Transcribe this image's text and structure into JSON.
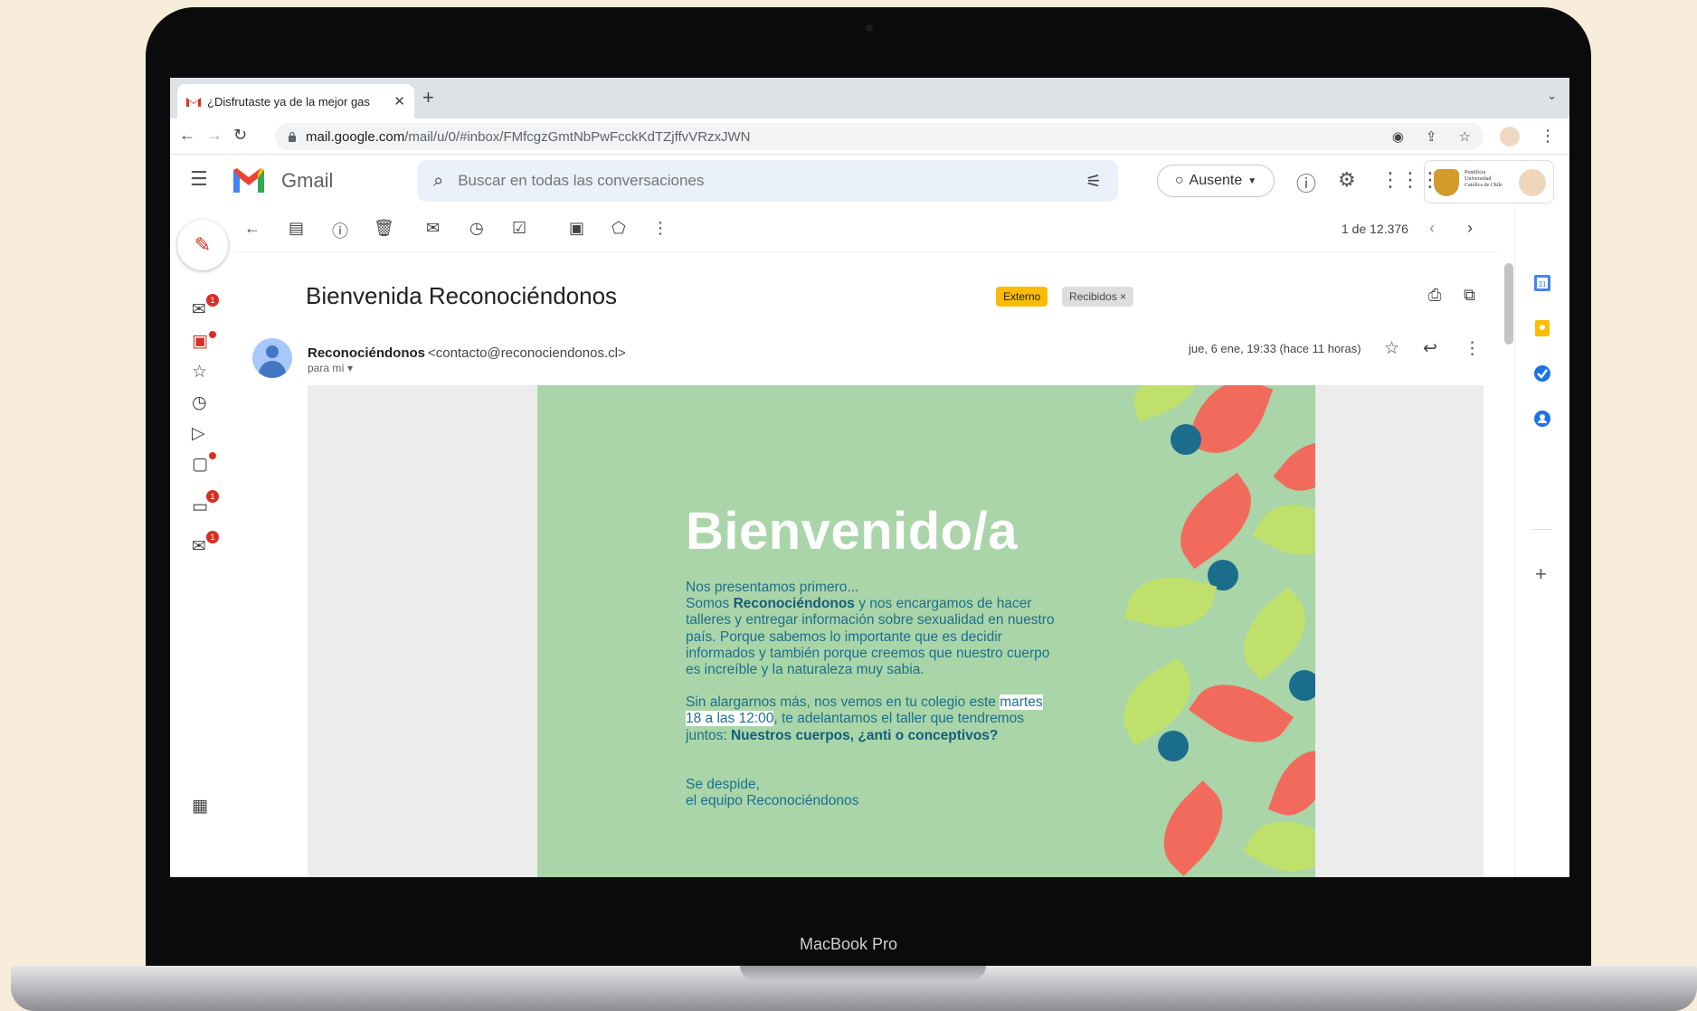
{
  "device": {
    "label": "MacBook Pro"
  },
  "browser": {
    "tab": {
      "title": "¿Disfrutaste ya de la mejor gas"
    },
    "url": {
      "host": "mail.google.com",
      "path": "/mail/u/0/#inbox/FMfcgzGmtNbPwFcckKdTZjffvVRzxJWN"
    }
  },
  "gmail": {
    "app_name": "Gmail",
    "search": {
      "placeholder": "Buscar en todas las conversaciones"
    },
    "status": {
      "label": "Ausente"
    },
    "org": {
      "name": "Pontificia Universidad Católica de Chile"
    },
    "rail": {
      "badges": [
        "1",
        "1",
        "1"
      ]
    },
    "pager": "1 de 12.376",
    "message": {
      "subject": "Bienvenida Reconociéndonos",
      "labels": {
        "external": "Externo",
        "inbox": "Recibidos"
      },
      "sender_name": "Reconociéndonos",
      "sender_email": "<contacto@reconociendonos.cl>",
      "to": "para mí",
      "date": "jue, 6 ene, 19:33 (hace 11 horas)",
      "poster": {
        "title": "Bienvenido/a",
        "p1_line1": "Nos presentamos primero...",
        "p1_pre": "Somos ",
        "p1_brand": "Reconociéndonos",
        "p1_rest": " y nos encargamos de hacer talleres y entregar información sobre sexualidad en nuestro país. Porque sabemos lo importante que es decidir informados y también porque creemos que nuestro cuerpo es increíble y la naturaleza muy sabia.",
        "p2_pre": "Sin alargarnos más, nos vemos en tu colegio este ",
        "p2_highlight": "martes 18 a las 12:00",
        "p2_mid": ", te adelantamos el taller que tendremos juntos: ",
        "p2_workshop": "Nuestros cuerpos, ¿anti o conceptivos?",
        "p3_line1": "Se despide,",
        "p3_line2": "el equipo Reconociéndonos"
      }
    }
  },
  "colors": {
    "poster_bg": "#a9d5a8",
    "coral": "#f26a5b",
    "lime": "#c0e06c",
    "teal": "#1b6d8c",
    "gmail_red": "#d93025"
  }
}
